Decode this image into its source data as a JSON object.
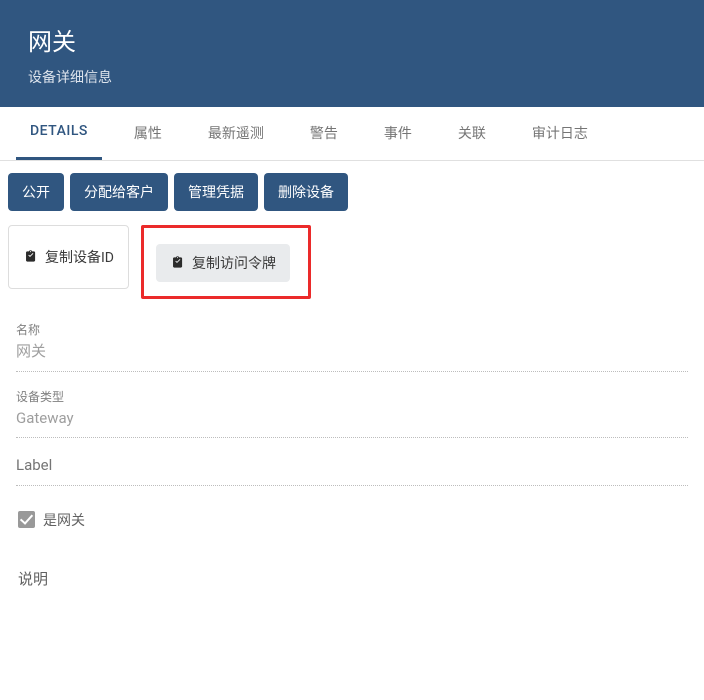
{
  "header": {
    "title": "网关",
    "subtitle": "设备详细信息"
  },
  "tabs": [
    {
      "label": "DETAILS",
      "active": true
    },
    {
      "label": "属性",
      "active": false
    },
    {
      "label": "最新遥测",
      "active": false
    },
    {
      "label": "警告",
      "active": false
    },
    {
      "label": "事件",
      "active": false
    },
    {
      "label": "关联",
      "active": false
    },
    {
      "label": "审计日志",
      "active": false
    }
  ],
  "actions": {
    "public": "公开",
    "assign_customer": "分配给客户",
    "manage_creds": "管理凭据",
    "delete_device": "删除设备",
    "copy_id": "复制设备ID",
    "copy_token": "复制访问令牌"
  },
  "fields": {
    "name_label": "名称",
    "name_value": "网关",
    "type_label": "设备类型",
    "type_value": "Gateway",
    "label_label": "Label",
    "label_value": "",
    "is_gateway_label": "是网关",
    "description_label": "说明"
  }
}
